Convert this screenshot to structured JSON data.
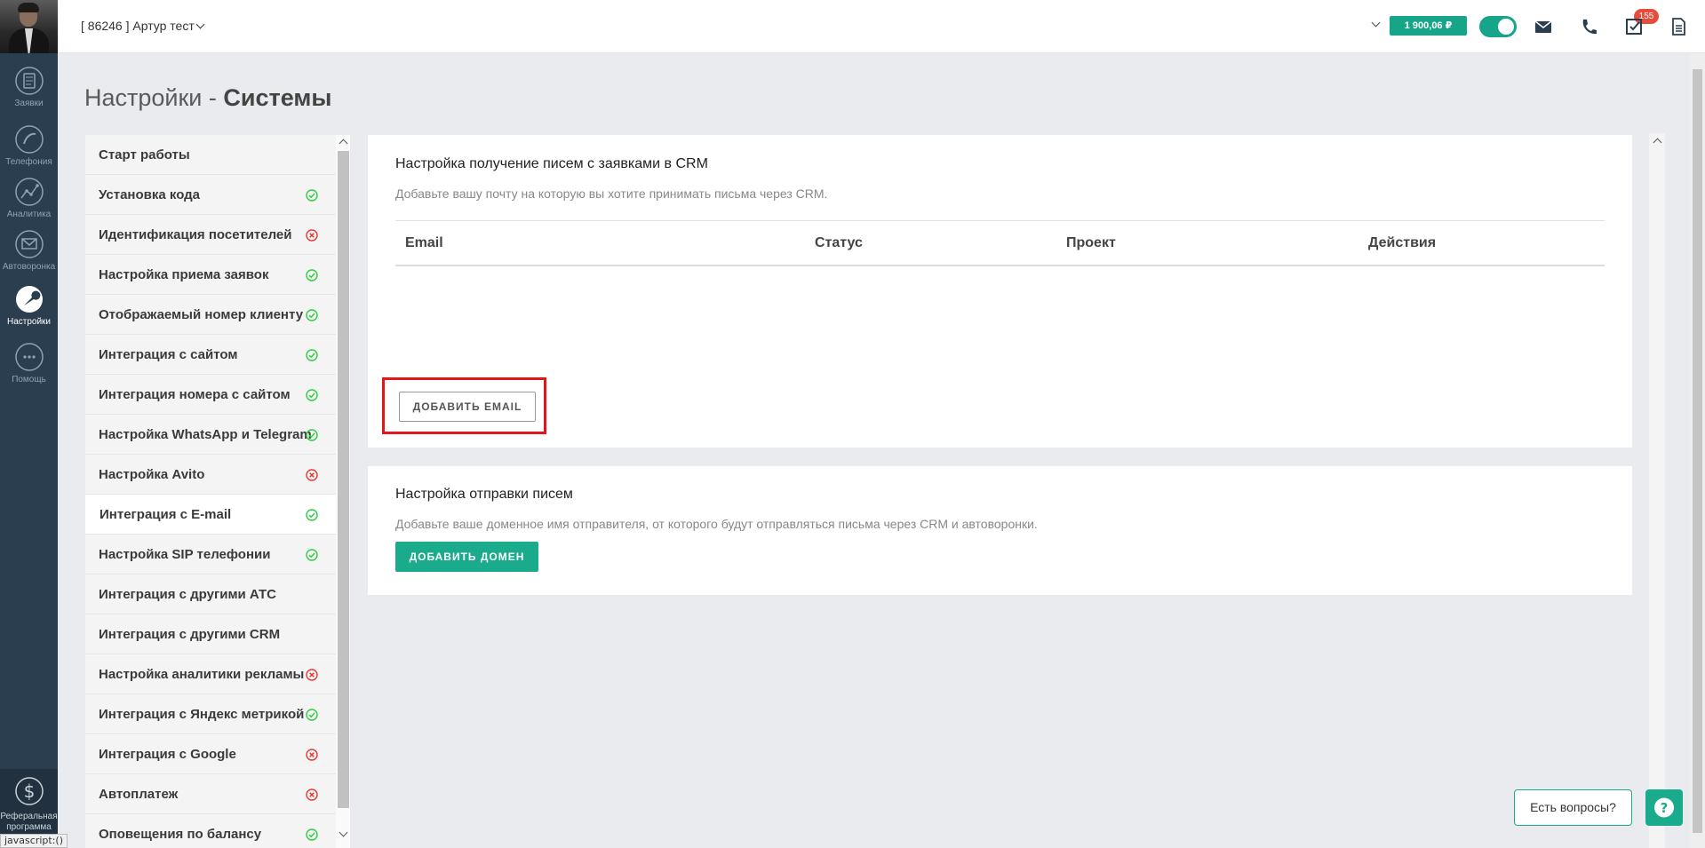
{
  "leftnav": {
    "items": [
      {
        "label": "Заявки",
        "icon": "requests-icon"
      },
      {
        "label": "Телефония",
        "icon": "phone-handset-icon"
      },
      {
        "label": "Аналитика",
        "icon": "analytics-icon"
      },
      {
        "label": "Автоворонка",
        "icon": "mail-funnel-icon"
      },
      {
        "label": "Настройки",
        "icon": "wrench-icon"
      },
      {
        "label": "Помощь",
        "icon": "chat-bubble-icon"
      }
    ],
    "referral_label": "Реферальная программа",
    "referral_icon": "dollar-icon"
  },
  "topbar": {
    "account": "[ 86246 ] Артур тест",
    "balance": "1 900,06 ₽",
    "notifications_count": "155",
    "icons": [
      "mail-icon",
      "phone-icon",
      "checklist-icon",
      "document-icon"
    ]
  },
  "page": {
    "title_prefix": "Настройки - ",
    "title_bold": "Системы"
  },
  "sidebar": {
    "items": [
      {
        "label": "Старт работы",
        "status": "none"
      },
      {
        "label": "Установка кода",
        "status": "ok"
      },
      {
        "label": "Идентификация посетителей",
        "status": "error"
      },
      {
        "label": "Настройка приема заявок",
        "status": "ok"
      },
      {
        "label": "Отображаемый номер клиенту",
        "status": "ok"
      },
      {
        "label": "Интеграция с сайтом",
        "status": "ok"
      },
      {
        "label": "Интеграция номера с сайтом",
        "status": "ok"
      },
      {
        "label": "Настройка WhatsApp и Telegram",
        "status": "ok"
      },
      {
        "label": "Настройка Avito",
        "status": "error"
      },
      {
        "label": "Интеграция с E-mail",
        "status": "ok",
        "active": true
      },
      {
        "label": "Настройка SIP телефонии",
        "status": "ok"
      },
      {
        "label": "Интеграция с другими АТС",
        "status": "none"
      },
      {
        "label": "Интеграция с другими CRM",
        "status": "none"
      },
      {
        "label": "Настройка аналитики рекламы",
        "status": "error"
      },
      {
        "label": "Интеграция с Яндекс метрикой",
        "status": "ok"
      },
      {
        "label": "Интеграция с Google",
        "status": "error"
      },
      {
        "label": "Автоплатеж",
        "status": "error"
      },
      {
        "label": "Оповещения по балансу",
        "status": "ok"
      }
    ]
  },
  "email_card": {
    "title": "Настройка получение писем с заявками в CRM",
    "subtitle": "Добавьте вашу почту на которую вы хотите принимать письма через CRM.",
    "columns": [
      "Email",
      "Статус",
      "Проект",
      "Действия"
    ],
    "add_button": "ДОБАВИТЬ EMAIL"
  },
  "sender_card": {
    "title": "Настройка отправки писем",
    "subtitle": "Добавьте ваше доменное имя отправителя, от которого будут отправляться письма через CRM и автоворонки.",
    "add_button": "ДОБАВИТЬ ДОМЕН"
  },
  "help": {
    "label": "Есть вопросы?"
  },
  "status_bar": "javascript:()",
  "colors": {
    "accent": "#1aaa8c",
    "nav_bg": "#2b3e50",
    "ok": "#2ecc40",
    "error": "#e53935",
    "highlight": "#e5151c"
  }
}
